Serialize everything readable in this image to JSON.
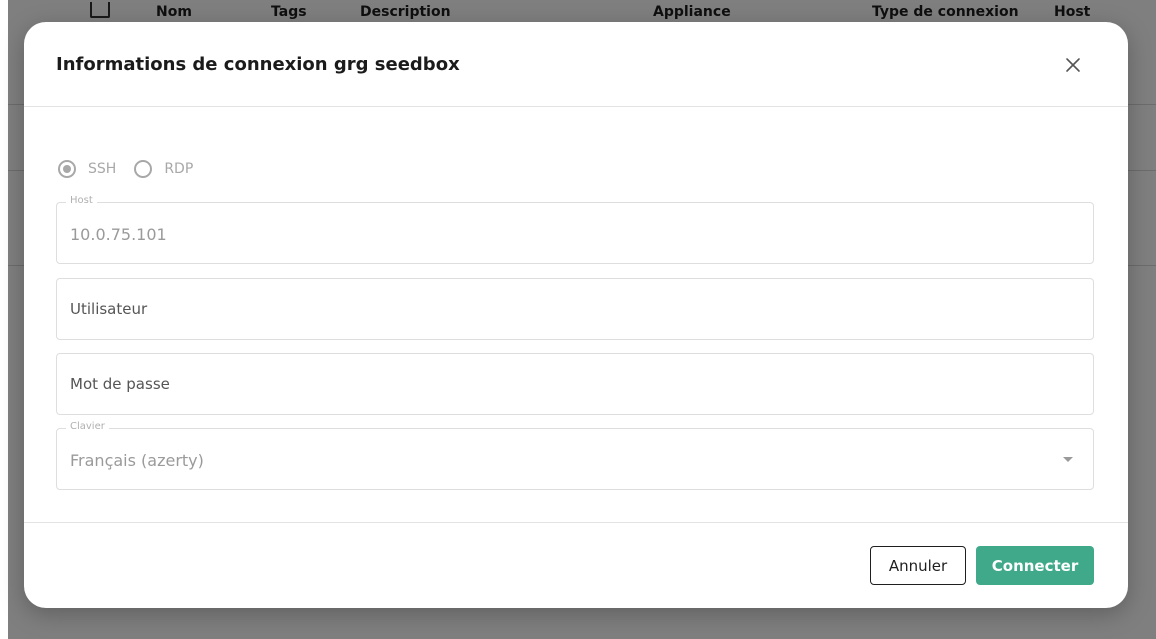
{
  "background_table": {
    "columns": [
      "Nom",
      "Tags",
      "Description",
      "Appliance",
      "Type de connexion",
      "Host"
    ]
  },
  "dialog": {
    "title": "Informations de connexion grg seedbox",
    "close_icon": "close-icon",
    "protocol_options": [
      {
        "label": "SSH",
        "selected": true
      },
      {
        "label": "RDP",
        "selected": false
      }
    ],
    "host": {
      "label": "Host",
      "value": "10.0.75.101"
    },
    "user": {
      "placeholder": "Utilisateur"
    },
    "password": {
      "placeholder": "Mot de passe"
    },
    "keyboard": {
      "label": "Clavier",
      "value": "Français (azerty)"
    },
    "cancel_label": "Annuler",
    "connect_label": "Connecter"
  },
  "colors": {
    "accent": "#3fa98a",
    "overlay": "rgba(0,0,0,0.5)"
  }
}
